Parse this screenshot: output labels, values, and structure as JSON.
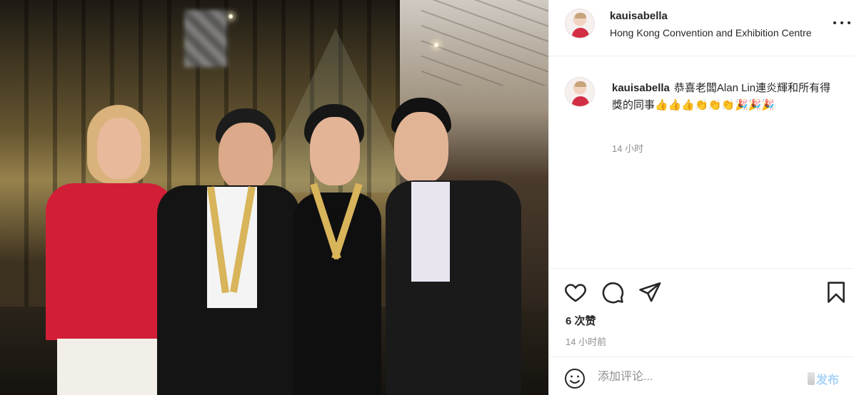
{
  "post": {
    "username": "kauisabella",
    "location": "Hong Kong Convention and Exhibition Centre"
  },
  "caption": {
    "username": "kauisabella",
    "text": "恭喜老闆Alan Lin連炎輝和所有得獎的同事👍👍👍👏👏👏🎉🎉🎉",
    "time": "14 小时"
  },
  "actions": {
    "likes": "6 次赞",
    "time": "14 小时前"
  },
  "add_comment": {
    "placeholder": "添加评论...",
    "post_label": "发布"
  },
  "icons": {
    "more": "more-dots-icon",
    "like": "heart-icon",
    "comment": "speech-bubble-icon",
    "share": "paper-plane-icon",
    "save": "bookmark-icon",
    "emoji": "smiley-icon"
  },
  "colors": {
    "text": "#262626",
    "secondary_text": "#8e8e8e",
    "border": "#efefef",
    "post_button_disabled": "#a9d3f7"
  }
}
